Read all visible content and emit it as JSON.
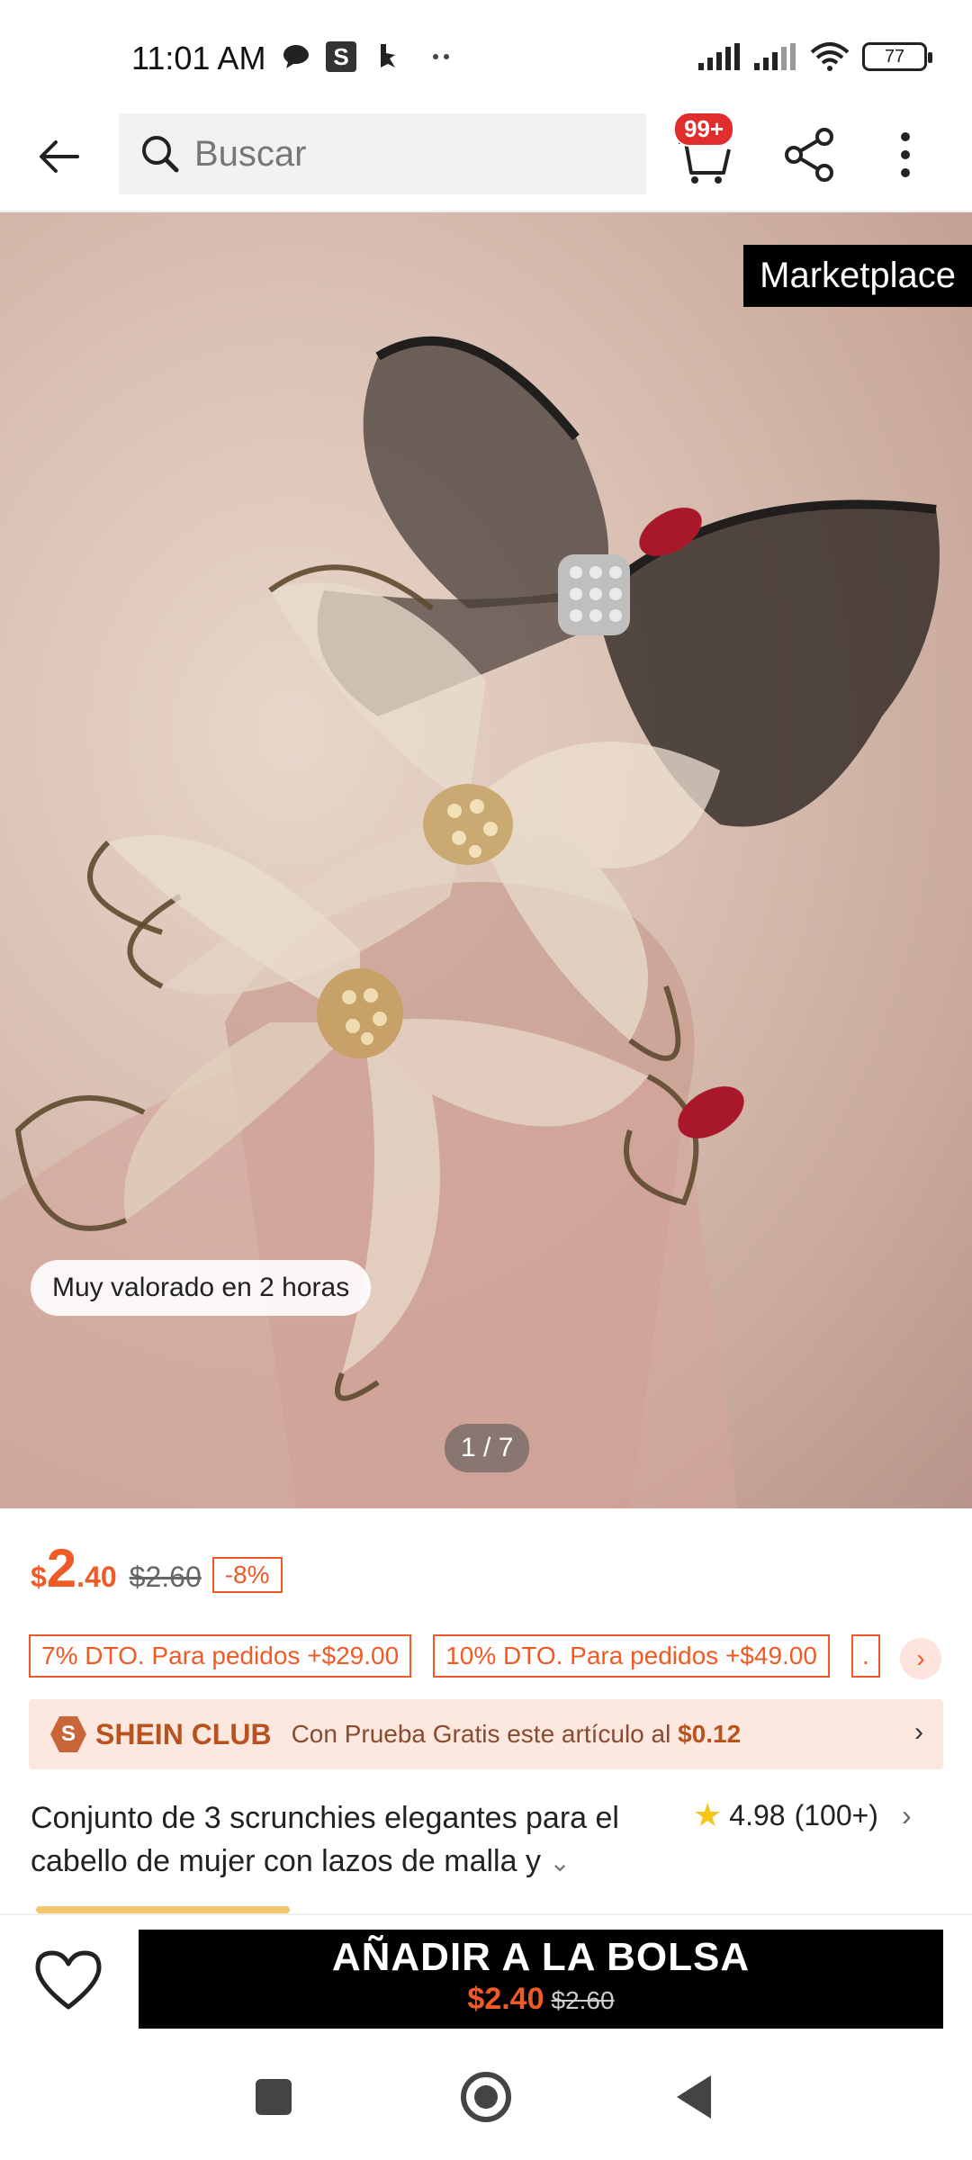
{
  "status_bar": {
    "time": "11:01 AM",
    "battery": "77",
    "icons": [
      "chat-icon",
      "s-app-icon",
      "b-app-icon",
      "more-dots-icon",
      "signal-icon",
      "signal-icon",
      "wifi-icon",
      "battery-icon"
    ]
  },
  "appbar": {
    "search_placeholder": "Buscar",
    "cart_badge": "99+"
  },
  "gallery": {
    "marketplace_label": "Marketplace",
    "highlight_chip": "Muy valorado en 2 horas",
    "page_indicator": "1 / 7"
  },
  "price": {
    "currency": "$",
    "integer": "2",
    "decimal": ".40",
    "original": "$2.60",
    "discount": "-8%"
  },
  "coupons": [
    "7% DTO. Para pedidos +$29.00",
    "10% DTO. Para pedidos +$49.00",
    "."
  ],
  "club": {
    "logo_letter": "S",
    "name": "SHEIN CLUB",
    "text": "Con Prueba Gratis este artículo al",
    "price": "$0.12"
  },
  "product": {
    "title": "Conjunto de 3 scrunchies elegantes para el cabello de mujer con lazos de malla y",
    "rating": "4.98",
    "review_count": "(100+)"
  },
  "bottom_bar": {
    "add_to_bag": "AÑADIR A LA BOLSA",
    "price_now": "$2.40",
    "price_was": "$2.60"
  },
  "colors": {
    "accent": "#f05a27",
    "badge": "#e02d2d",
    "club_bg": "#fde8e0",
    "cta_bg": "#000000"
  }
}
